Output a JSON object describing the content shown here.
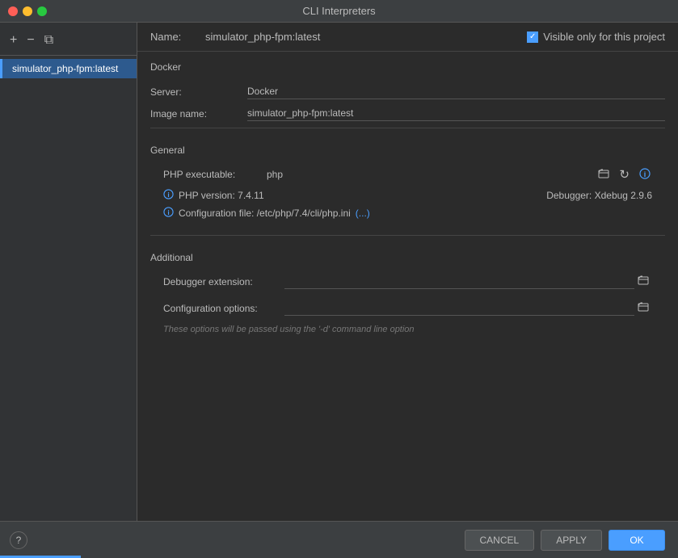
{
  "titleBar": {
    "title": "CLI Interpreters"
  },
  "sidebar": {
    "addBtn": "+",
    "removeBtn": "−",
    "copyBtn": "⧉",
    "items": [
      {
        "label": "simulator_php-fpm:latest",
        "active": true
      }
    ]
  },
  "nameRow": {
    "label": "Name:",
    "value": "simulator_php-fpm:latest",
    "visibleCheckbox": {
      "checked": true,
      "label": "Visible only for this project"
    }
  },
  "dockerSection": {
    "title": "Docker",
    "serverLabel": "Server:",
    "serverValue": "Docker",
    "imageNameLabel": "Image name:",
    "imageNameValue": "simulator_php-fpm:latest"
  },
  "generalSection": {
    "title": "General",
    "phpExecLabel": "PHP executable:",
    "phpExecValue": "php",
    "phpVersionLabel": "PHP version:",
    "phpVersionValue": "PHP version: 7.4.11",
    "debuggerLabel": "Debugger:",
    "debuggerValue": "Debugger: Xdebug 2.9.6",
    "configFileText": "Configuration file: /etc/php/7.4/cli/php.ini",
    "configFileLink": "(...)"
  },
  "additionalSection": {
    "title": "Additional",
    "debuggerExtLabel": "Debugger extension:",
    "configOptionsLabel": "Configuration options:",
    "hintText": "These options will be passed using the '-d' command line option"
  },
  "bottomBar": {
    "helpLabel": "?",
    "cancelLabel": "CANCEL",
    "applyLabel": "APPLY",
    "okLabel": "OK"
  },
  "icons": {
    "folder": "📁",
    "refresh": "↻",
    "info": "ℹ",
    "checkmark": "✓"
  }
}
